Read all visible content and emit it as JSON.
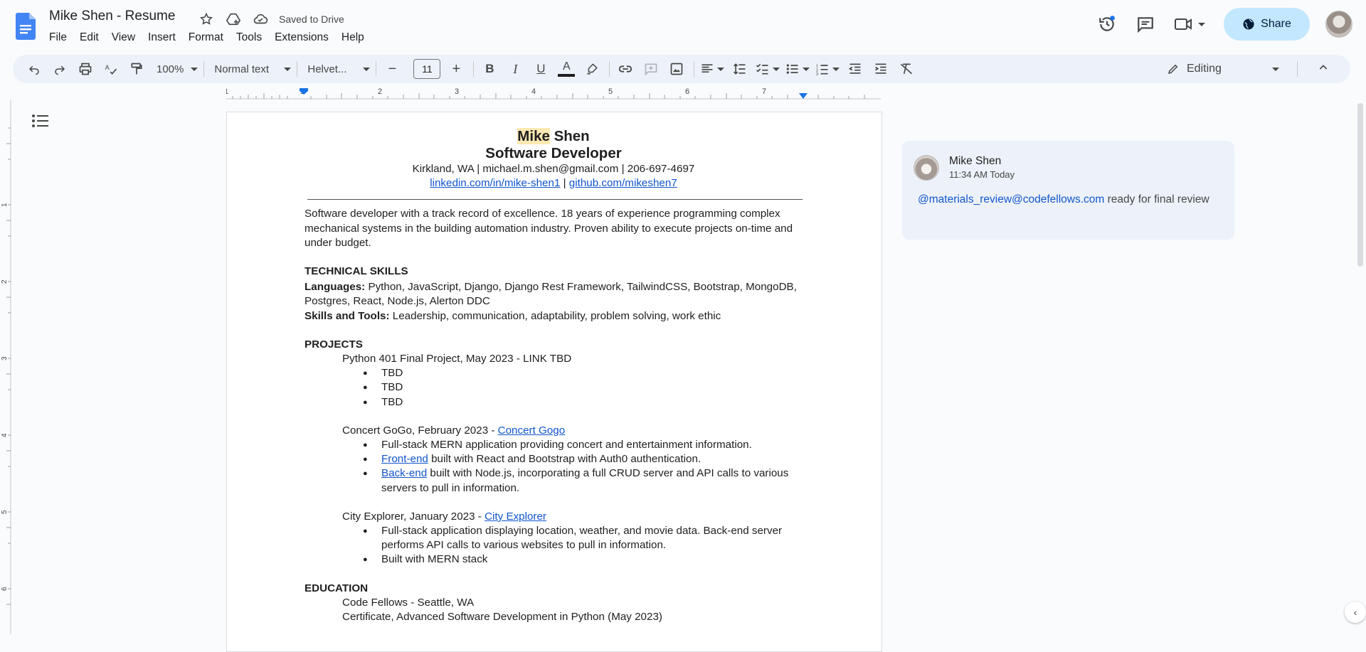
{
  "header": {
    "title": "Mike Shen - Resume",
    "saved_status": "Saved to Drive",
    "share_label": "Share"
  },
  "menu": [
    "File",
    "Edit",
    "View",
    "Insert",
    "Format",
    "Tools",
    "Extensions",
    "Help"
  ],
  "toolbar": {
    "zoom": "100%",
    "style": "Normal text",
    "font": "Helvet...",
    "font_size": "11",
    "mode": "Editing",
    "text_color": "#1f1f1f"
  },
  "ruler": {
    "labels": [
      "1",
      "1",
      "2",
      "3",
      "4",
      "5",
      "6",
      "7"
    ]
  },
  "vruler": {
    "labels": [
      "1",
      "2",
      "3",
      "4",
      "5",
      "6"
    ]
  },
  "document": {
    "name_first": "Mike",
    "name_last": " Shen",
    "role": "Software Developer",
    "contact": "Kirkland, WA | michael.m.shen@gmail.com | 206-697-4697",
    "linkedin": "linkedin.com/in/mike-shen1",
    "link_sep": " | ",
    "github": "github.com/mikeshen7",
    "summary": "Software developer with a track record of excellence.  18 years of experience programming complex mechanical systems in the building automation industry.  Proven ability to execute projects on-time and under budget.",
    "skills_heading": "TECHNICAL SKILLS",
    "languages_label": "Languages:",
    "languages_value": " Python, JavaScript, Django, Django Rest Framework, TailwindCSS, Bootstrap, MongoDB, Postgres, React, Node.js, Alerton DDC",
    "tools_label": "Skills and Tools:",
    "tools_value": " Leadership, communication, adaptability, problem solving, work ethic",
    "projects_heading": "PROJECTS",
    "project1_title": "Python 401 Final Project, May 2023 - LINK TBD",
    "project1_bullets": [
      "TBD",
      "TBD",
      "TBD"
    ],
    "project2_title": "Concert GoGo, February 2023 - ",
    "project2_link": "Concert Gogo",
    "project2_b1": "Full-stack MERN application providing concert and entertainment information.",
    "project2_b2_link": "Front-end",
    "project2_b2_text": " built with React and Bootstrap with Auth0 authentication.",
    "project2_b3_link": "Back-end",
    "project2_b3_text": " built with Node.js, incorporating a full CRUD server and API calls to various servers to pull in information.",
    "project3_title": "City Explorer, January 2023 - ",
    "project3_link": "City Explorer",
    "project3_b1": "Full-stack application displaying location, weather, and movie data.  Back-end server performs API calls to various websites to pull in information.",
    "project3_b2": "Built with MERN stack",
    "education_heading": "EDUCATION",
    "edu_school": "Code Fellows - Seattle, WA",
    "edu_cert": "Certificate, Advanced Software Development in Python (May 2023)"
  },
  "comment": {
    "author": "Mike Shen",
    "time": "11:34 AM Today",
    "mention": "@materials_review@codefellows.com",
    "text": " ready for final review"
  }
}
